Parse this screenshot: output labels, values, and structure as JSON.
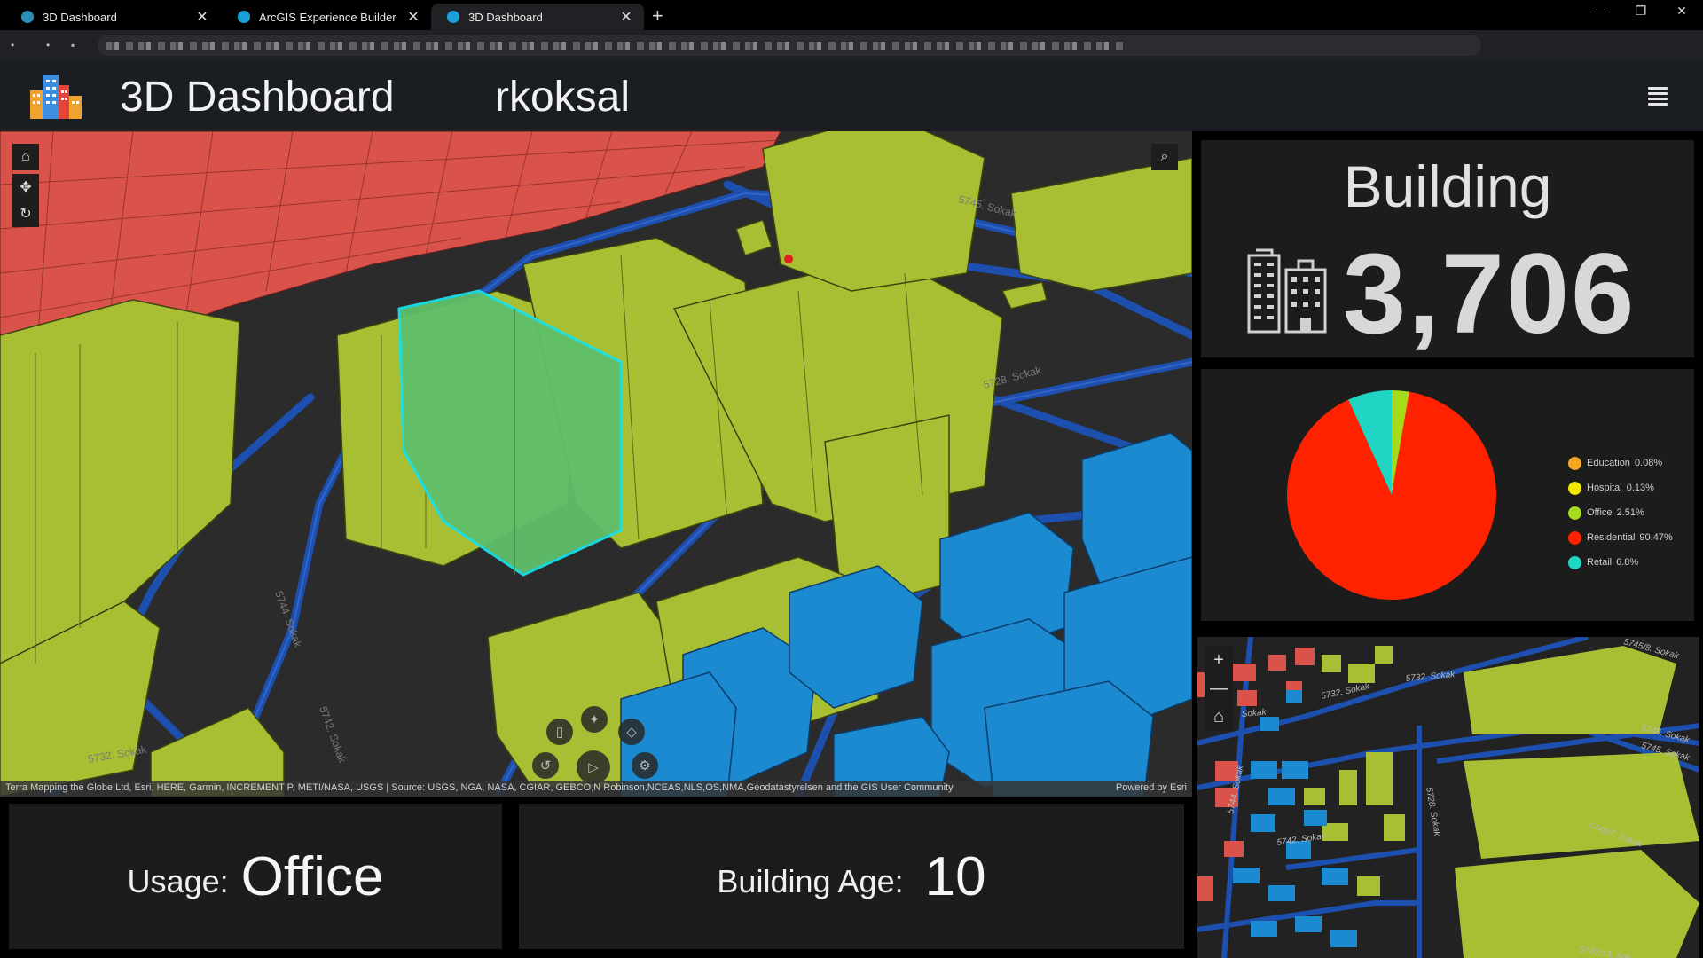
{
  "browser": {
    "tabs": [
      {
        "title": "3D Dashboard",
        "active": false
      },
      {
        "title": "ArcGIS Experience Builder",
        "active": false
      },
      {
        "title": "3D Dashboard",
        "active": true
      }
    ],
    "close_glyph": "✕",
    "new_tab_glyph": "+",
    "window_controls": [
      "—",
      "❐",
      "✕"
    ]
  },
  "header": {
    "title": "3D Dashboard",
    "user": "rkoksal",
    "logo_icon": "city-buildings-icon",
    "menu_icon": "hamburger-menu-icon"
  },
  "scene": {
    "left_tools": [
      {
        "name": "home-icon",
        "glyph": "⌂"
      },
      {
        "name": "pan-icon",
        "glyph": "✥"
      },
      {
        "name": "rotate-icon",
        "glyph": "↻"
      }
    ],
    "search_glyph": "⌕",
    "bottom_tools": [
      {
        "name": "mouse-icon",
        "glyph": "▯"
      },
      {
        "name": "select-icon",
        "glyph": "✦"
      },
      {
        "name": "eraser-icon",
        "glyph": "◇"
      },
      {
        "name": "reset-icon",
        "glyph": "↺"
      },
      {
        "name": "play-icon",
        "glyph": "▷"
      },
      {
        "name": "settings-icon",
        "glyph": "⚙"
      }
    ],
    "street_labels": [
      "5728. Sokak",
      "5742. Sokak",
      "5744. Sokak",
      "5732. Sokak",
      "5745. Sokak"
    ],
    "attribution": "Terra Mapping the Globe Ltd, Esri, HERE, Garmin, INCREMENT P, METI/NASA, USGS | Source: USGS, NGA, NASA, CGIAR, GEBCO,N Robinson,NCEAS,NLS,OS,NMA,Geodatastyrelsen and the GIS User Community",
    "powered_by": "Powered by Esri",
    "colors": {
      "residential": "#d9534a",
      "office": "#a8bf33",
      "selected": "#5fbf6a",
      "blue": "#1b8ad0",
      "road": "#1c4fae",
      "ground": "#2b2b2b"
    }
  },
  "info": {
    "usage_label": "Usage:",
    "usage_value": "Office",
    "age_label": "Building Age:",
    "age_value": "10"
  },
  "building_panel": {
    "title": "Building",
    "count": "3,706"
  },
  "pie_legend": [
    {
      "label": "Education",
      "pct": "0.08%",
      "color": "#f5a623"
    },
    {
      "label": "Hospital",
      "pct": "0.13%",
      "color": "#f3e600"
    },
    {
      "label": "Office",
      "pct": "2.51%",
      "color": "#a4dc1c"
    },
    {
      "label": "Residential",
      "pct": "90.47%",
      "color": "#ff2200"
    },
    {
      "label": "Retail",
      "pct": "6.8%",
      "color": "#1fd6c4"
    }
  ],
  "chart_data": {
    "type": "pie",
    "categories": [
      "Education",
      "Hospital",
      "Office",
      "Residential",
      "Retail"
    ],
    "values": [
      0.08,
      0.13,
      2.51,
      90.47,
      6.8
    ],
    "colors": [
      "#f5a623",
      "#f3e600",
      "#a4dc1c",
      "#ff2200",
      "#1fd6c4"
    ],
    "legend_position": "right"
  },
  "map2d": {
    "zoom_in": "+",
    "zoom_out": "—",
    "home_glyph": "⌂",
    "street_labels": [
      "5745/8. Sokak",
      "5732. Sokak",
      "5732. Sokak",
      "5745. Sokak",
      "5745. Sokak",
      "5728. Sokak",
      "5742. Sokak",
      "5744. Sokak",
      "5745/7. Sokak",
      "5747/13. Sok.",
      "Sokak"
    ]
  }
}
